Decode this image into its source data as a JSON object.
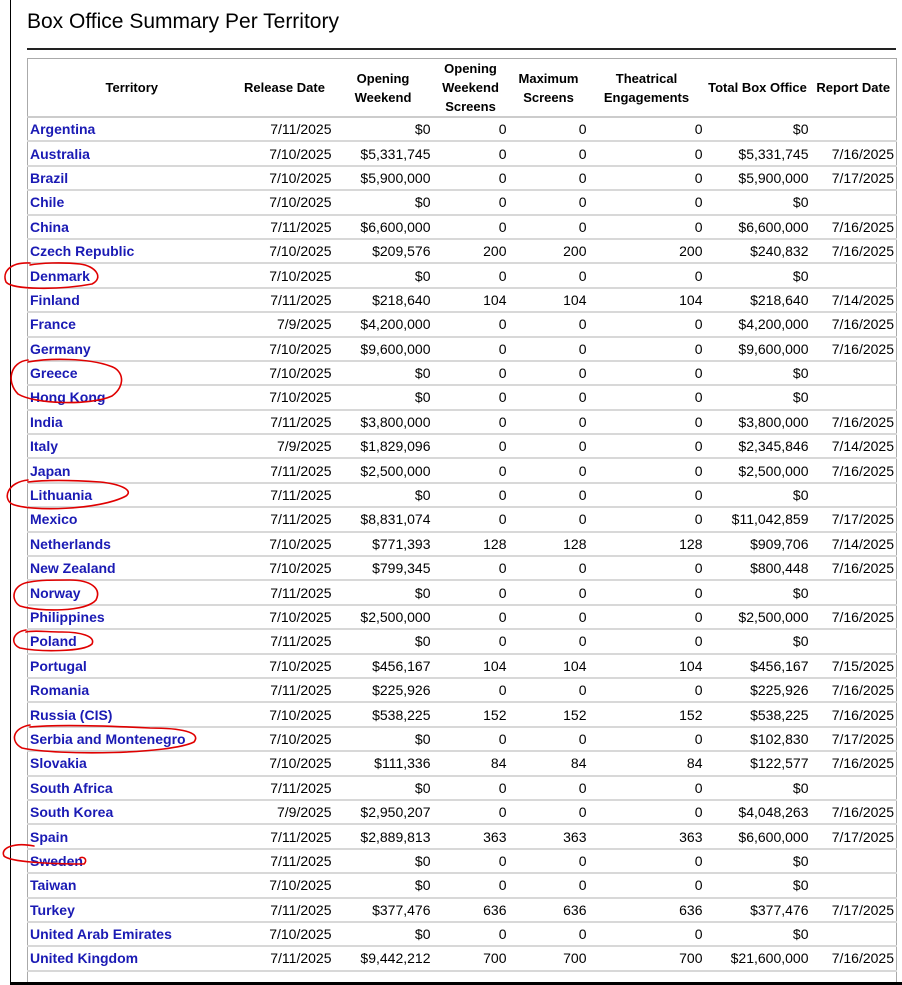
{
  "title": "Box Office Summary Per Territory",
  "columns": [
    "Territory",
    "Release Date",
    "Opening Weekend",
    "Opening Weekend Screens",
    "Maximum Screens",
    "Theatrical Engagements",
    "Total Box Office",
    "Report Date"
  ],
  "rows": [
    [
      "Argentina",
      "7/11/2025",
      "$0",
      "0",
      "0",
      "0",
      "$0",
      ""
    ],
    [
      "Australia",
      "7/10/2025",
      "$5,331,745",
      "0",
      "0",
      "0",
      "$5,331,745",
      "7/16/2025"
    ],
    [
      "Brazil",
      "7/10/2025",
      "$5,900,000",
      "0",
      "0",
      "0",
      "$5,900,000",
      "7/17/2025"
    ],
    [
      "Chile",
      "7/10/2025",
      "$0",
      "0",
      "0",
      "0",
      "$0",
      ""
    ],
    [
      "China",
      "7/11/2025",
      "$6,600,000",
      "0",
      "0",
      "0",
      "$6,600,000",
      "7/16/2025"
    ],
    [
      "Czech Republic",
      "7/10/2025",
      "$209,576",
      "200",
      "200",
      "200",
      "$240,832",
      "7/16/2025"
    ],
    [
      "Denmark",
      "7/10/2025",
      "$0",
      "0",
      "0",
      "0",
      "$0",
      ""
    ],
    [
      "Finland",
      "7/11/2025",
      "$218,640",
      "104",
      "104",
      "104",
      "$218,640",
      "7/14/2025"
    ],
    [
      "France",
      "7/9/2025",
      "$4,200,000",
      "0",
      "0",
      "0",
      "$4,200,000",
      "7/16/2025"
    ],
    [
      "Germany",
      "7/10/2025",
      "$9,600,000",
      "0",
      "0",
      "0",
      "$9,600,000",
      "7/16/2025"
    ],
    [
      "Greece",
      "7/10/2025",
      "$0",
      "0",
      "0",
      "0",
      "$0",
      ""
    ],
    [
      "Hong Kong",
      "7/10/2025",
      "$0",
      "0",
      "0",
      "0",
      "$0",
      ""
    ],
    [
      "India",
      "7/11/2025",
      "$3,800,000",
      "0",
      "0",
      "0",
      "$3,800,000",
      "7/16/2025"
    ],
    [
      "Italy",
      "7/9/2025",
      "$1,829,096",
      "0",
      "0",
      "0",
      "$2,345,846",
      "7/14/2025"
    ],
    [
      "Japan",
      "7/11/2025",
      "$2,500,000",
      "0",
      "0",
      "0",
      "$2,500,000",
      "7/16/2025"
    ],
    [
      "Lithuania",
      "7/11/2025",
      "$0",
      "0",
      "0",
      "0",
      "$0",
      ""
    ],
    [
      "Mexico",
      "7/11/2025",
      "$8,831,074",
      "0",
      "0",
      "0",
      "$11,042,859",
      "7/17/2025"
    ],
    [
      "Netherlands",
      "7/10/2025",
      "$771,393",
      "128",
      "128",
      "128",
      "$909,706",
      "7/14/2025"
    ],
    [
      "New Zealand",
      "7/10/2025",
      "$799,345",
      "0",
      "0",
      "0",
      "$800,448",
      "7/16/2025"
    ],
    [
      "Norway",
      "7/11/2025",
      "$0",
      "0",
      "0",
      "0",
      "$0",
      ""
    ],
    [
      "Philippines",
      "7/10/2025",
      "$2,500,000",
      "0",
      "0",
      "0",
      "$2,500,000",
      "7/16/2025"
    ],
    [
      "Poland",
      "7/11/2025",
      "$0",
      "0",
      "0",
      "0",
      "$0",
      ""
    ],
    [
      "Portugal",
      "7/10/2025",
      "$456,167",
      "104",
      "104",
      "104",
      "$456,167",
      "7/15/2025"
    ],
    [
      "Romania",
      "7/11/2025",
      "$225,926",
      "0",
      "0",
      "0",
      "$225,926",
      "7/16/2025"
    ],
    [
      "Russia (CIS)",
      "7/10/2025",
      "$538,225",
      "152",
      "152",
      "152",
      "$538,225",
      "7/16/2025"
    ],
    [
      "Serbia and Montenegro",
      "7/10/2025",
      "$0",
      "0",
      "0",
      "0",
      "$102,830",
      "7/17/2025"
    ],
    [
      "Slovakia",
      "7/10/2025",
      "$111,336",
      "84",
      "84",
      "84",
      "$122,577",
      "7/16/2025"
    ],
    [
      "South Africa",
      "7/11/2025",
      "$0",
      "0",
      "0",
      "0",
      "$0",
      ""
    ],
    [
      "South Korea",
      "7/9/2025",
      "$2,950,207",
      "0",
      "0",
      "0",
      "$4,048,263",
      "7/16/2025"
    ],
    [
      "Spain",
      "7/11/2025",
      "$2,889,813",
      "363",
      "363",
      "363",
      "$6,600,000",
      "7/17/2025"
    ],
    [
      "Sweden",
      "7/11/2025",
      "$0",
      "0",
      "0",
      "0",
      "$0",
      ""
    ],
    [
      "Taiwan",
      "7/10/2025",
      "$0",
      "0",
      "0",
      "0",
      "$0",
      ""
    ],
    [
      "Turkey",
      "7/11/2025",
      "$377,476",
      "636",
      "636",
      "636",
      "$377,476",
      "7/17/2025"
    ],
    [
      "United Arab Emirates",
      "7/10/2025",
      "$0",
      "0",
      "0",
      "0",
      "$0",
      ""
    ],
    [
      "United Kingdom",
      "7/11/2025",
      "$9,442,212",
      "700",
      "700",
      "700",
      "$21,600,000",
      "7/16/2025"
    ]
  ],
  "annotation_color": "#e00000"
}
